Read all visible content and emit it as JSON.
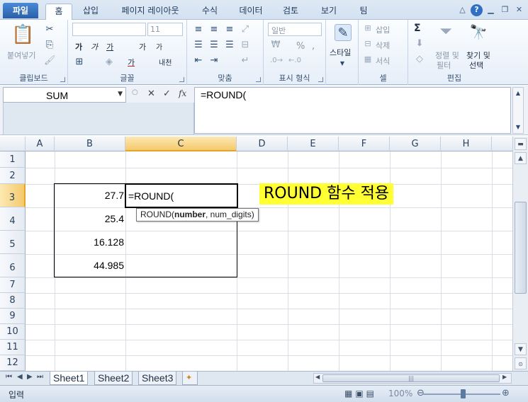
{
  "ribbon_tabs": [
    "파일",
    "홈",
    "삽입",
    "페이지 레이아웃",
    "수식",
    "데이터",
    "검토",
    "보기",
    "팀"
  ],
  "ribbon": {
    "clipboard": {
      "paste": "붙여넣기",
      "label": "클립보드"
    },
    "font": {
      "size": "11",
      "bold": "가",
      "italic": "가",
      "underline": "가",
      "grow": "가",
      "shrink": "가",
      "phonetic": "내천",
      "label": "글꼴"
    },
    "alignment": {
      "label": "맞춤"
    },
    "number": {
      "format": "일반",
      "percent": "%",
      "comma": ",",
      "label": "표시 형식"
    },
    "styles": {
      "style": "스타일"
    },
    "cells": {
      "insert": "삽입",
      "delete": "삭제",
      "format": "서식",
      "label": "셀"
    },
    "editing": {
      "sum": "Σ",
      "sort1": "정렬 및",
      "sort2": "필터",
      "find1": "찾기 및",
      "find2": "선택",
      "label": "편집"
    }
  },
  "formula_bar": {
    "name_box": "SUM",
    "fx": "fx",
    "formula": "=ROUND("
  },
  "grid": {
    "columns": [
      "A",
      "B",
      "C",
      "D",
      "E",
      "F",
      "G",
      "H"
    ],
    "rows": [
      "1",
      "2",
      "3",
      "4",
      "5",
      "6",
      "7",
      "8",
      "9",
      "10",
      "11",
      "12"
    ],
    "active_cell": {
      "col": "C",
      "row": "3"
    },
    "values": {
      "B3": "27.7",
      "B4": "25.4",
      "B5": "16.128",
      "B6": "44.985",
      "C3": "=ROUND("
    },
    "tooltip": {
      "func": "ROUND(",
      "arg1": "number",
      "rest": ", num_digits)"
    },
    "banner": "ROUND 함수 적용"
  },
  "sheets": [
    "Sheet1",
    "Sheet2",
    "Sheet3"
  ],
  "status": {
    "mode": "입력",
    "zoom": "100%"
  },
  "colors": {
    "banner": "#ffff33",
    "selected_header": "#f5c96c",
    "file_tab": "#2a5fa8"
  }
}
